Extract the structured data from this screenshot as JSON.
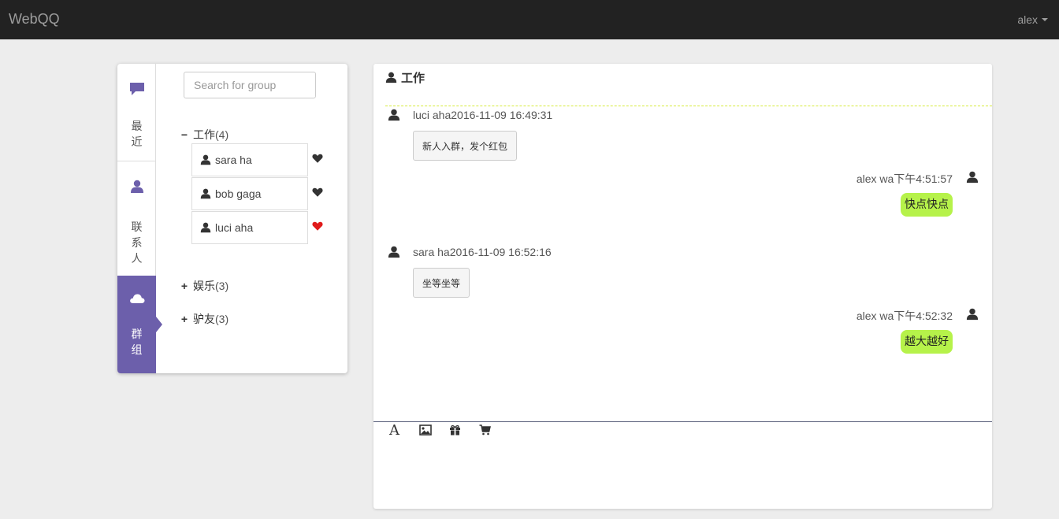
{
  "app": {
    "brand": "WebQQ",
    "user": "alex"
  },
  "sidebar": {
    "tabs": [
      {
        "label": "最近",
        "icon": "comment-icon",
        "active": false
      },
      {
        "label": "联系人",
        "icon": "user-icon",
        "active": false
      },
      {
        "label": "群组",
        "icon": "cloud-icon",
        "active": true
      }
    ]
  },
  "groups": {
    "search_placeholder": "Search for group",
    "list": [
      {
        "name": "工作",
        "count": "(4)",
        "expanded": true,
        "sign": "−",
        "members": [
          {
            "name": "sara ha",
            "favorite": false
          },
          {
            "name": "bob gaga",
            "favorite": false
          },
          {
            "name": "luci aha",
            "favorite": true
          }
        ]
      },
      {
        "name": "娱乐",
        "count": "(3)",
        "expanded": false,
        "sign": "+"
      },
      {
        "name": "驴友",
        "count": "(3)",
        "expanded": false,
        "sign": "+"
      }
    ]
  },
  "chat": {
    "title": "工作",
    "messages": [
      {
        "side": "left",
        "meta": "luci aha2016-11-09 16:49:31",
        "text": "新人入群，发个红包"
      },
      {
        "side": "right",
        "meta": "alex wa下午4:51:57",
        "text": "快点快点"
      },
      {
        "side": "left",
        "meta": "sara ha2016-11-09 16:52:16",
        "text": "坐等坐等"
      },
      {
        "side": "right",
        "meta": "alex wa下午4:52:32",
        "text": "越大越好"
      }
    ],
    "toolbar": {
      "font_glyph": "A"
    }
  },
  "colors": {
    "navbar": "#222222",
    "accent": "#6c5fab",
    "own_bubble": "#b6f24a",
    "favorite_heart": "#e01b1b",
    "heart": "#333333"
  }
}
